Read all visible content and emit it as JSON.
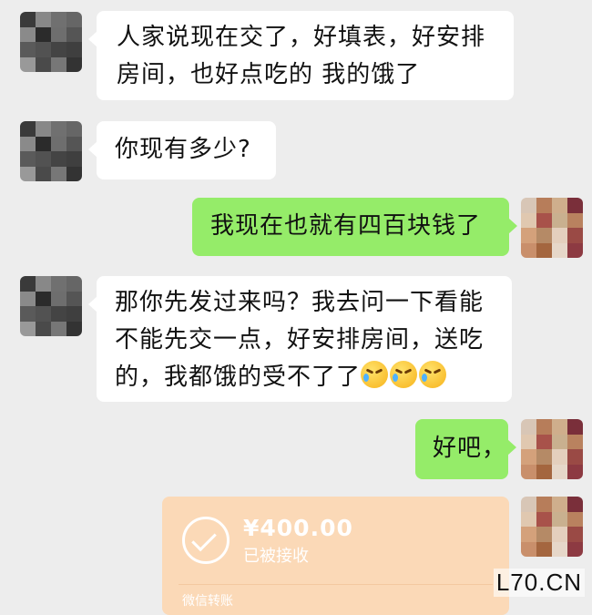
{
  "messages": [
    {
      "side": "left",
      "lines": [
        "人家说现在交了，好填表，好安排",
        "房间，也好点吃的 我的饿了"
      ]
    },
    {
      "side": "left",
      "lines": [
        "你现有多少?"
      ]
    },
    {
      "side": "right",
      "lines": [
        "我现在也就有四百块钱了"
      ]
    },
    {
      "side": "left",
      "lines": [
        "那你先发过来吗？我去问一下看能",
        "不能先交一点，好安排房间，送吃",
        "的，我都饿的受不了了"
      ],
      "trailing_icons": [
        "crying-face-emoji",
        "crying-face-emoji",
        "crying-face-emoji"
      ]
    },
    {
      "side": "right",
      "lines": [
        "好吧，"
      ]
    }
  ],
  "transfer": {
    "amount": "¥400.00",
    "status": "已被接收",
    "label": "微信转账",
    "icon": "check-circle-icon",
    "color": "#fbd9b7"
  },
  "watermark": "L70.CN",
  "colors": {
    "background": "#ededed",
    "left_bubble": "#ffffff",
    "right_bubble": "#95ec69"
  }
}
